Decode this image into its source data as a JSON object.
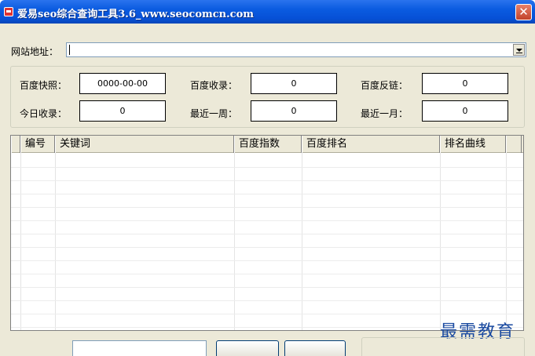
{
  "window": {
    "title": "爱易seo综合查询工具3.6_www.seocomcn.com",
    "close_glyph": "✕"
  },
  "url": {
    "label": "网站地址：",
    "value": ""
  },
  "stats": {
    "snapshot_label": "百度快照：",
    "snapshot_value": "0000-00-00",
    "indexed_label": "百度收录：",
    "indexed_value": "0",
    "backlinks_label": "百度反链：",
    "backlinks_value": "0",
    "today_label": "今日收录：",
    "today_value": "0",
    "week_label": "最近一周：",
    "week_value": "0",
    "month_label": "最近一月：",
    "month_value": "0"
  },
  "table": {
    "columns": [
      "编号",
      "关键词",
      "百度指数",
      "百度排名",
      "排名曲线"
    ],
    "rows": []
  },
  "watermark": "最需教育",
  "colors": {
    "titlebar": "#0650d6",
    "face": "#ece9d8",
    "close": "#c2432a",
    "watermark": "#1a4aa0"
  }
}
